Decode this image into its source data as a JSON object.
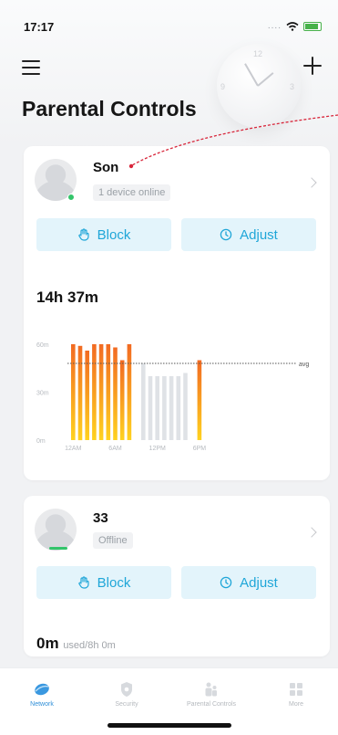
{
  "status_bar": {
    "time": "17:17",
    "signal": "...."
  },
  "header": {
    "title": "Parental Controls",
    "clock_numbers": [
      "12",
      "3",
      "9"
    ]
  },
  "profiles": [
    {
      "name": "Son",
      "status": "1 device online",
      "online": true,
      "block_label": "Block",
      "adjust_label": "Adjust",
      "usage_total": "14h 37m"
    },
    {
      "name": "33",
      "status": "Offline",
      "online": false,
      "block_label": "Block",
      "adjust_label": "Adjust",
      "usage_used": "0m",
      "usage_limit": "used/8h 0m"
    }
  ],
  "chart_data": {
    "type": "bar",
    "title": "",
    "xlabel": "",
    "ylabel": "",
    "yticks": [
      "60m",
      "30m",
      "0m"
    ],
    "xticks": [
      "12AM",
      "6AM",
      "12PM",
      "6PM"
    ],
    "ylim": [
      0,
      60
    ],
    "avg_label": "avg",
    "avg_value": 48,
    "grid": false,
    "hours": [
      0,
      1,
      2,
      3,
      4,
      5,
      6,
      7,
      8,
      9,
      10,
      11,
      12,
      13,
      14,
      15,
      16,
      17,
      18
    ],
    "values": [
      60,
      59,
      56,
      60,
      60,
      60,
      58,
      50,
      60,
      0,
      48,
      40,
      40,
      40,
      40,
      40,
      42,
      0,
      50
    ],
    "bar_kind": [
      "active",
      "active",
      "active",
      "active",
      "active",
      "active",
      "active",
      "active",
      "active",
      "none",
      "idle",
      "idle",
      "idle",
      "idle",
      "idle",
      "idle",
      "idle",
      "none",
      "active"
    ],
    "colors": {
      "active_top": "#f26a22",
      "active_bottom": "#ffd21f",
      "idle": "#dfe2e6",
      "avg_line": "#555555"
    }
  },
  "tabs": [
    {
      "label": "Network",
      "active": true
    },
    {
      "label": "Security",
      "active": false
    },
    {
      "label": "Parental Controls",
      "active": false
    },
    {
      "label": "More",
      "active": false
    }
  ],
  "colors": {
    "accent": "#1fa6d8",
    "button_bg": "#e3f4fb",
    "online": "#33c46a",
    "annotation": "#d8253a"
  }
}
